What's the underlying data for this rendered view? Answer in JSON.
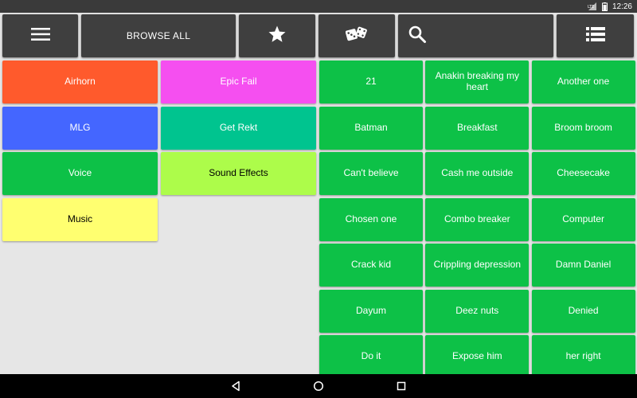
{
  "status": {
    "time": "12:26",
    "network_label": "LTE"
  },
  "toolbar": {
    "browse_all_label": "BROWSE ALL"
  },
  "icons": {
    "menu": "hamburger-menu-icon",
    "favorites": "star-icon",
    "random": "dice-icon",
    "search": "search-icon",
    "list_view": "list-view-icon"
  },
  "colors": {
    "toolbar_bg": "#3f3f3f",
    "sound_green": "#0dc147"
  },
  "categories": [
    {
      "label": "Airhorn",
      "color": "#ff5a2c",
      "text_color": "#ffffff"
    },
    {
      "label": "Epic Fail",
      "color": "#f54ff0",
      "text_color": "#ffffff"
    },
    {
      "label": "MLG",
      "color": "#4466ff",
      "text_color": "#ffffff"
    },
    {
      "label": "Get Rekt",
      "color": "#00c48f",
      "text_color": "#ffffff"
    },
    {
      "label": "Voice",
      "color": "#0dc147",
      "text_color": "#ffffff"
    },
    {
      "label": "Sound Effects",
      "color": "#adfc4a",
      "text_color": "#000000"
    },
    {
      "label": "Music",
      "color": "#ffff70",
      "text_color": "#000000"
    }
  ],
  "sounds": [
    "21",
    "Anakin breaking my heart",
    "Another one",
    "Batman",
    "Breakfast",
    "Broom broom",
    "Can't believe",
    "Cash me outside",
    "Cheesecake",
    "Chosen one",
    "Combo breaker",
    "Computer",
    "Crack kid",
    "Crippling depression",
    "Damn Daniel",
    "Dayum",
    "Deez nuts",
    "Denied",
    "Do it",
    "Expose him",
    "her right"
  ]
}
